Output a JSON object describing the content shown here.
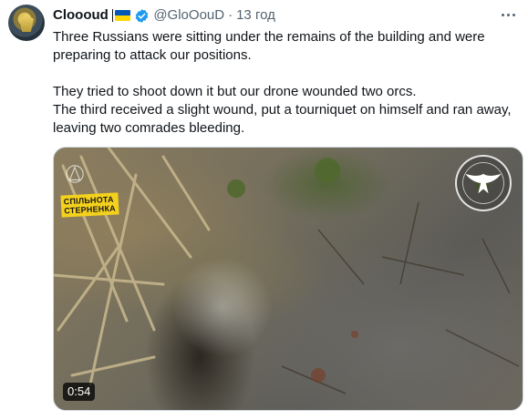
{
  "tweet": {
    "author": {
      "display_name": "Cloooud",
      "handle": "@GloOouD",
      "avatar_icon": "avatar-image",
      "flag_colors": [
        "#0057b7",
        "#ffd700"
      ],
      "verified_color": "#1d9bf0"
    },
    "separator": "·",
    "timestamp": "13 год",
    "text": {
      "para1": "Three Russians were sitting under the remains of the building and were preparing to attack our positions.",
      "para2_line1": "They tried to shoot down it but our drone wounded two orcs.",
      "para2_line2": "The third received a slight wound, put a tourniquet on himself and ran away, leaving two comrades bleeding."
    },
    "media": {
      "badge_line1": "СПІЛЬНОТА",
      "badge_line2": "СТЕРНЕНКА",
      "duration": "0:54"
    }
  }
}
